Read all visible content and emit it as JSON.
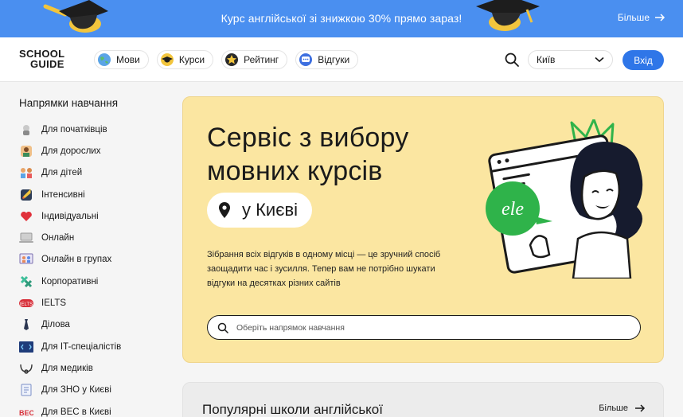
{
  "promo": {
    "text": "Курс англійської зі знижкою 30% прямо зараз!",
    "more": "Більше",
    "bg": "#4a8ff0"
  },
  "header": {
    "logo_line1": "SCHOOL",
    "logo_line2": "GUIDE",
    "nav": [
      {
        "label": "Мови",
        "icon": "globe-icon"
      },
      {
        "label": "Курси",
        "icon": "graduation-cap-icon"
      },
      {
        "label": "Рейтинг",
        "icon": "star-icon"
      },
      {
        "label": "Відгуки",
        "icon": "chat-icon"
      }
    ],
    "city": "Київ",
    "login": "Вхід",
    "accent": "#2f76e8"
  },
  "sidebar": {
    "title": "Напрямки навчання",
    "items": [
      {
        "label": "Для початківців",
        "icon": "beginner-icon"
      },
      {
        "label": "Для дорослих",
        "icon": "adult-icon"
      },
      {
        "label": "Для дітей",
        "icon": "children-icon"
      },
      {
        "label": "Інтенсивні",
        "icon": "rocket-icon"
      },
      {
        "label": "Індивідуальні",
        "icon": "heart-icon"
      },
      {
        "label": "Онлайн",
        "icon": "laptop-icon"
      },
      {
        "label": "Онлайн в групах",
        "icon": "video-group-icon"
      },
      {
        "label": "Корпоративні",
        "icon": "puzzle-icon"
      },
      {
        "label": "IELTS",
        "icon": "ielts-icon"
      },
      {
        "label": "Ділова",
        "icon": "tie-icon"
      },
      {
        "label": "Для IT-спеціалістів",
        "icon": "code-icon"
      },
      {
        "label": "Для медиків",
        "icon": "stethoscope-icon"
      },
      {
        "label": "Для ЗНО у Києві",
        "icon": "test-sheet-icon"
      },
      {
        "label": "Для ВЕС в Києві",
        "icon": "bec-icon"
      }
    ]
  },
  "hero": {
    "title_line1": "Сервіс з вибору",
    "title_line2": "мовних курсів",
    "city": "у Києві",
    "description": "Зібрання всіх відгуків в одному місці — це зручний спосіб заощадити час і зусилля. Тепер вам не потрібно шукати відгуки на десятках різних сайтів",
    "search_placeholder": "Оберіть напрямок навчання",
    "bubble_text": "ele",
    "bg": "#fbe6a1"
  },
  "popular": {
    "title": "Популярні школи англійської",
    "more": "Більше"
  }
}
